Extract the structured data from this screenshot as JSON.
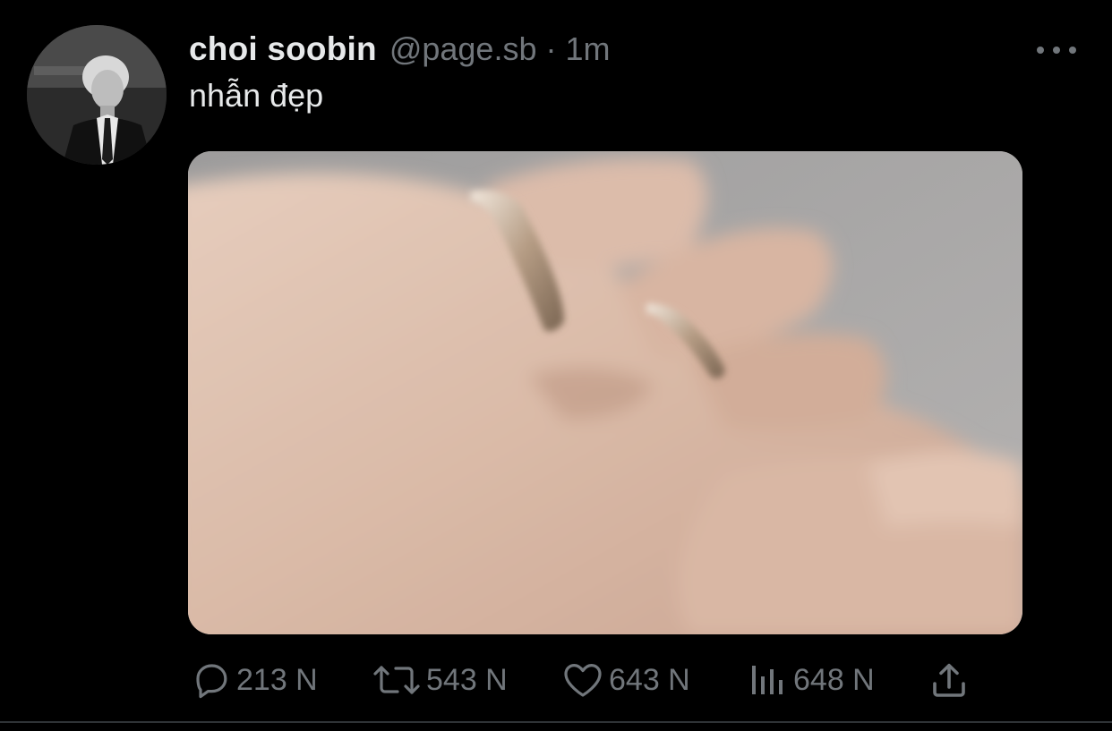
{
  "author": {
    "display_name": "choi soobin",
    "handle": "@page.sb",
    "separator": "·",
    "time": "1m"
  },
  "tweet": {
    "text": "nhẫn đẹp"
  },
  "actions": {
    "reply": {
      "icon": "reply-icon",
      "count": "213 N"
    },
    "retweet": {
      "icon": "retweet-icon",
      "count": "543 N"
    },
    "like": {
      "icon": "heart-icon",
      "count": "643 N"
    },
    "views": {
      "icon": "views-icon",
      "count": "648 N"
    },
    "share": {
      "icon": "share-icon"
    }
  },
  "colors": {
    "background": "#000000",
    "primary_text": "#e7e9ea",
    "secondary_text": "#71767b"
  }
}
